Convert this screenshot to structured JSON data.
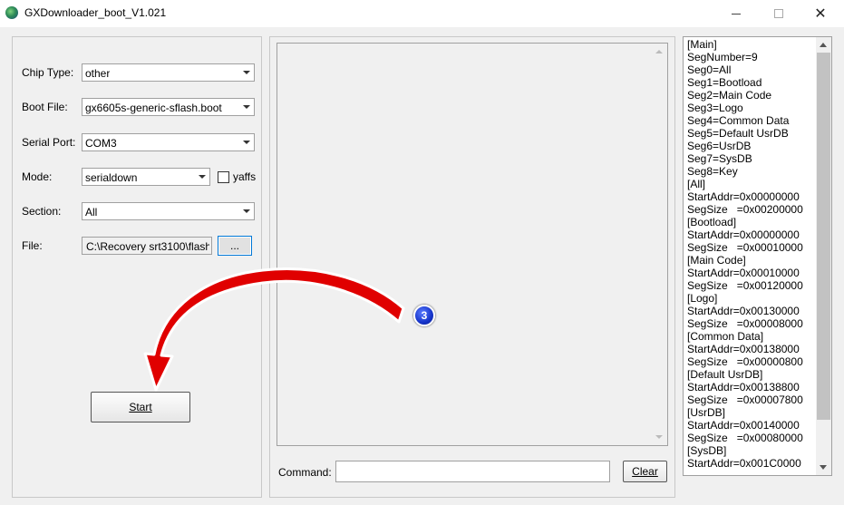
{
  "window": {
    "title": "GXDownloader_boot_V1.021"
  },
  "form": {
    "chip_type": {
      "label": "Chip Type:",
      "value": "other"
    },
    "boot_file": {
      "label": "Boot File:",
      "value": "gx6605s-generic-sflash.boot"
    },
    "serial_port": {
      "label": "Serial Port:",
      "value": "COM3"
    },
    "mode": {
      "label": "Mode:",
      "value": "serialdown",
      "yaffs_label": "yaffs"
    },
    "section": {
      "label": "Section:",
      "value": "All"
    },
    "file": {
      "label": "File:",
      "value": "C:\\Recovery srt3100\\flash",
      "browse_label": "..."
    },
    "start_label": "Start"
  },
  "console": {
    "command_label": "Command:",
    "command_value": "",
    "clear_label": "Clear"
  },
  "config_lines": [
    "[Main]",
    "SegNumber=9",
    "Seg0=All",
    "Seg1=Bootload",
    "Seg2=Main Code",
    "Seg3=Logo",
    "Seg4=Common Data",
    "Seg5=Default UsrDB",
    "Seg6=UsrDB",
    "Seg7=SysDB",
    "Seg8=Key",
    "[All]",
    "StartAddr=0x00000000",
    "SegSize   =0x00200000",
    "[Bootload]",
    "StartAddr=0x00000000",
    "SegSize   =0x00010000",
    "[Main Code]",
    "StartAddr=0x00010000",
    "SegSize   =0x00120000",
    "[Logo]",
    "StartAddr=0x00130000",
    "SegSize   =0x00008000",
    "[Common Data]",
    "StartAddr=0x00138000",
    "SegSize   =0x00000800",
    "[Default UsrDB]",
    "StartAddr=0x00138800",
    "SegSize   =0x00007800",
    "[UsrDB]",
    "StartAddr=0x00140000",
    "SegSize   =0x00080000",
    "[SysDB]",
    "StartAddr=0x001C0000"
  ],
  "annotation": {
    "step_number": "3",
    "arrow_color": "#e00000"
  }
}
